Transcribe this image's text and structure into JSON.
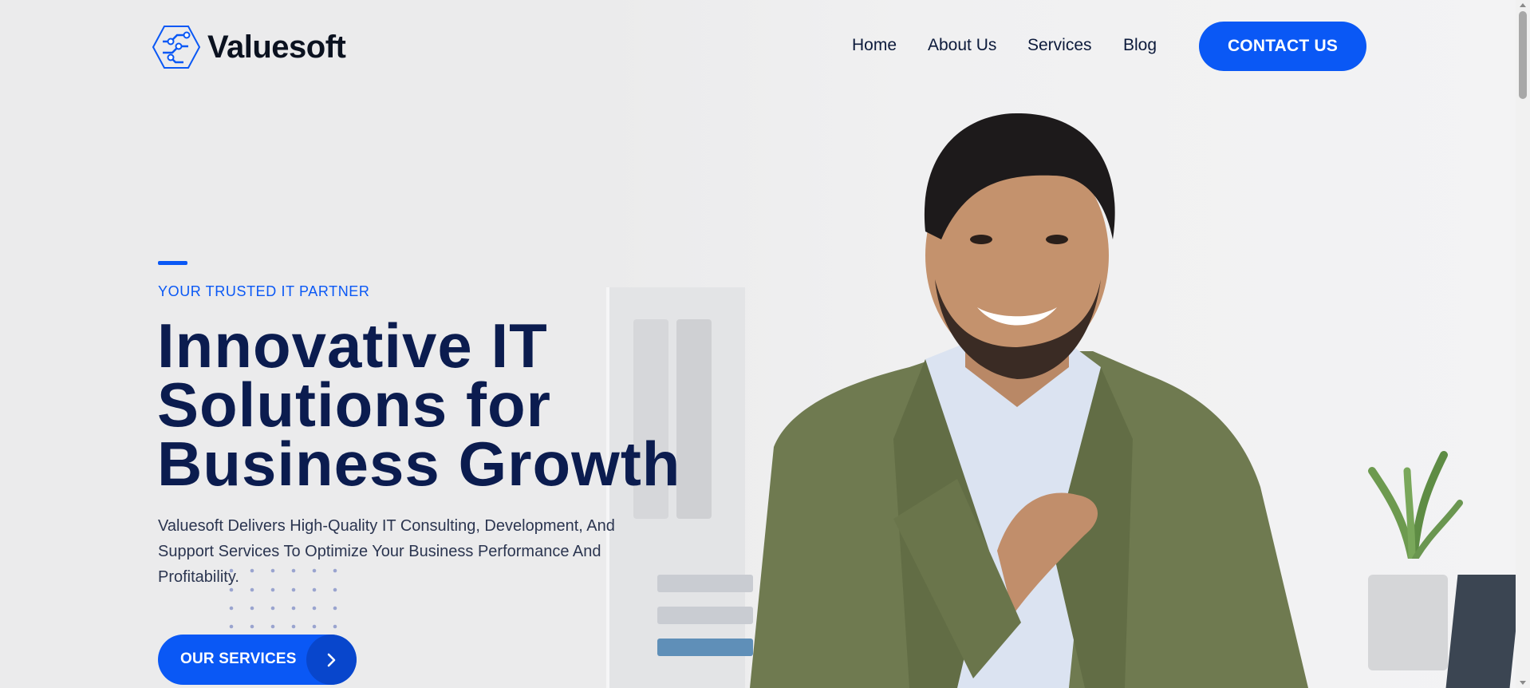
{
  "header": {
    "brand": "Valuesoft",
    "nav": [
      {
        "label": "Home"
      },
      {
        "label": "About Us"
      },
      {
        "label": "Services"
      },
      {
        "label": "Blog"
      }
    ],
    "contact_label": "CONTACT US"
  },
  "hero": {
    "eyebrow": "YOUR TRUSTED IT PARTNER",
    "headline": [
      "Innovative IT",
      "Solutions for",
      "Business Growth"
    ],
    "description": "Valuesoft Delivers High-Quality IT Consulting, Development, And Support Services To Optimize Your Business Performance And Profitability.",
    "cta_label": "OUR SERVICES"
  },
  "colors": {
    "accent": "#0a58f5",
    "heading": "#0b1c4f",
    "background": "#ebebec"
  },
  "icons": [
    "logo-mark-icon",
    "chevron-right-icon",
    "dot-grid-icon"
  ]
}
